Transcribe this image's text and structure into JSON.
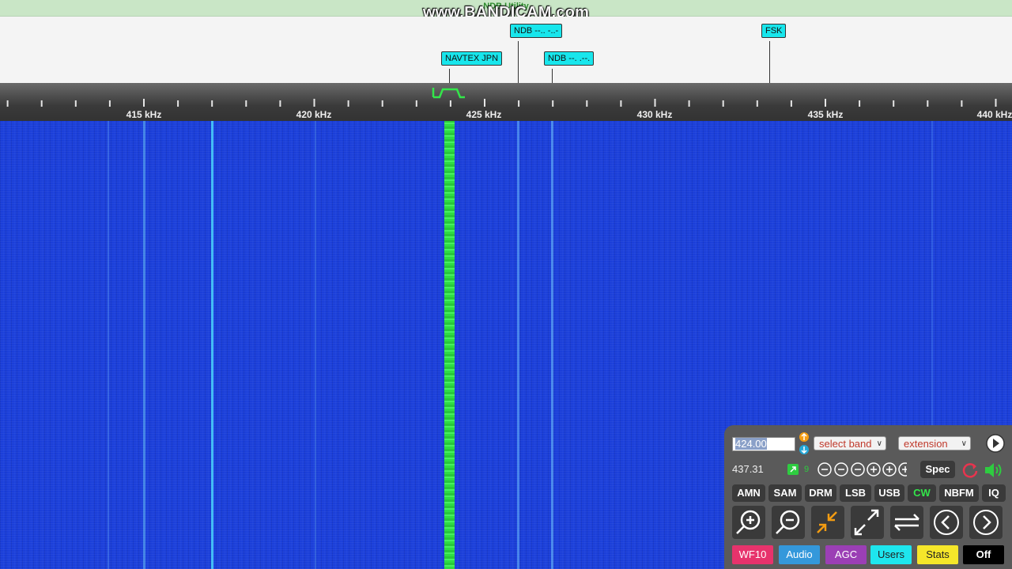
{
  "band_title": "NDB Utility",
  "watermark": "www.BANDICAM.com",
  "dx_labels": [
    {
      "text": "NAVTEX JPN"
    },
    {
      "text": "NDB --.. -..-"
    },
    {
      "text": "NDB --. .--."
    },
    {
      "text": "FSK"
    }
  ],
  "scale": {
    "ticks": [
      "415 kHz",
      "420 kHz",
      "425 kHz",
      "430 kHz",
      "435 kHz",
      "440 kHz"
    ]
  },
  "panel": {
    "frequency_input": "424.00",
    "band_select": "select band",
    "extension_select": "extension",
    "readout_freq": "437.31",
    "zoom_level": "9",
    "spec_label": "Spec",
    "modes": [
      "AMN",
      "SAM",
      "DRM",
      "LSB",
      "USB",
      "CW",
      "NBFM",
      "IQ"
    ],
    "active_mode": "CW",
    "bottom_buttons": {
      "wf": "WF10",
      "audio": "Audio",
      "agc": "AGC",
      "users": "Users",
      "stats": "Stats",
      "off": "Off"
    }
  },
  "colors": {
    "waterfall_bg": "#1b3fd9",
    "signal_green": "#33e64a",
    "label_cyan": "#18e6ec",
    "active_mode": "#33e64a"
  }
}
